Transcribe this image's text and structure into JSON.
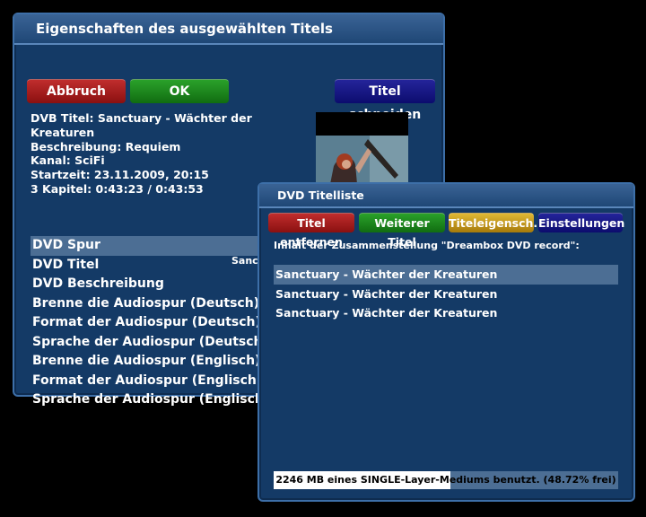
{
  "properties_window": {
    "title": "Eigenschaften des ausgewählten Titels",
    "buttons": {
      "cancel": "Abbruch",
      "ok": "OK",
      "cut": "Titel schneiden"
    },
    "info_lines": [
      "DVB Titel: Sanctuary - Wächter der",
      "Kreaturen",
      "Beschreibung:  Requiem",
      "Kanal: SciFi",
      "Startzeit: 23.11.2009, 20:15",
      "3 Kapitel: 0:43:23 / 0:43:53"
    ],
    "menu": [
      "DVD Spur",
      "DVD Titel",
      "DVD Beschreibung",
      "Brenne die Audiospur (Deutsch)",
      "Format der Audiospur (Deutsch)",
      "Sprache der Audiospur (Deutsch)",
      "Brenne die Audiospur (Englisch)",
      "Format der Audiospur (Englisch)",
      "Sprache der Audiospur (Englisch)"
    ],
    "selected_index": 0,
    "visible_value": "Sanc"
  },
  "titlelist_window": {
    "title": "DVD Titelliste",
    "buttons": {
      "remove": "Titel entfernen",
      "next": "Weiterer Titel",
      "properties": "Titeleigensch.",
      "settings": "Einstellungen"
    },
    "subtitle": "Inhalt der Zusammenstellung \"Dreambox DVD record\":",
    "titles": [
      "Sanctuary - Wächter der Kreaturen",
      "Sanctuary - Wächter der Kreaturen",
      "Sanctuary - Wächter der Kreaturen"
    ],
    "selected_index": 0,
    "usage_text": "2246 MB eines SINGLE-Layer-Mediums benutzt. (48.72% frei)",
    "usage_fraction": 0.5128
  },
  "colors": {
    "red": "#b01f1f",
    "green": "#1f8a1f",
    "yellow": "#d0a520",
    "blue": "#16167f",
    "window_bg": "#143a66",
    "selection": "#4c6e94"
  }
}
